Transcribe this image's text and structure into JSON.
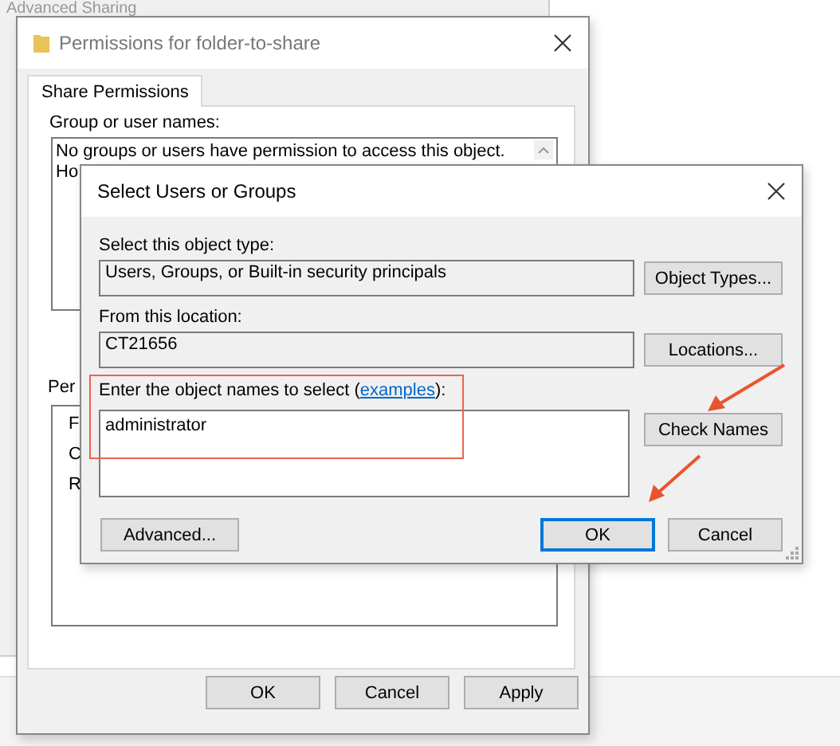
{
  "background_window": {
    "title": "Advanced Sharing"
  },
  "permissions_window": {
    "title": "Permissions for folder-to-share",
    "tabs": [
      {
        "label": "Share Permissions",
        "selected": true
      }
    ],
    "group_label": "Group or user names:",
    "group_lines": [
      "No groups or users have permission to access this object.",
      "Ho"
    ],
    "permissions_label": "Per",
    "permission_rows": [
      "F",
      "C",
      "R"
    ],
    "buttons": [
      {
        "label": "OK",
        "default": false
      },
      {
        "label": "Cancel",
        "default": false
      },
      {
        "label": "Apply",
        "default": false
      }
    ]
  },
  "select_dialog": {
    "title": "Select Users or Groups",
    "object_type_label": "Select this object type:",
    "object_type_value": "Users, Groups, or Built-in security principals",
    "object_types_button": "Object Types...",
    "location_label": "From this location:",
    "location_value": "CT21656",
    "locations_button": "Locations...",
    "names_label": {
      "before": "Enter the object names to select (",
      "link": "examples",
      "after": "):"
    },
    "names_value": "administrator",
    "check_names_button": "Check Names",
    "advanced_button": "Advanced...",
    "buttons": [
      {
        "label": "OK",
        "default": true
      },
      {
        "label": "Cancel",
        "default": false
      }
    ]
  }
}
